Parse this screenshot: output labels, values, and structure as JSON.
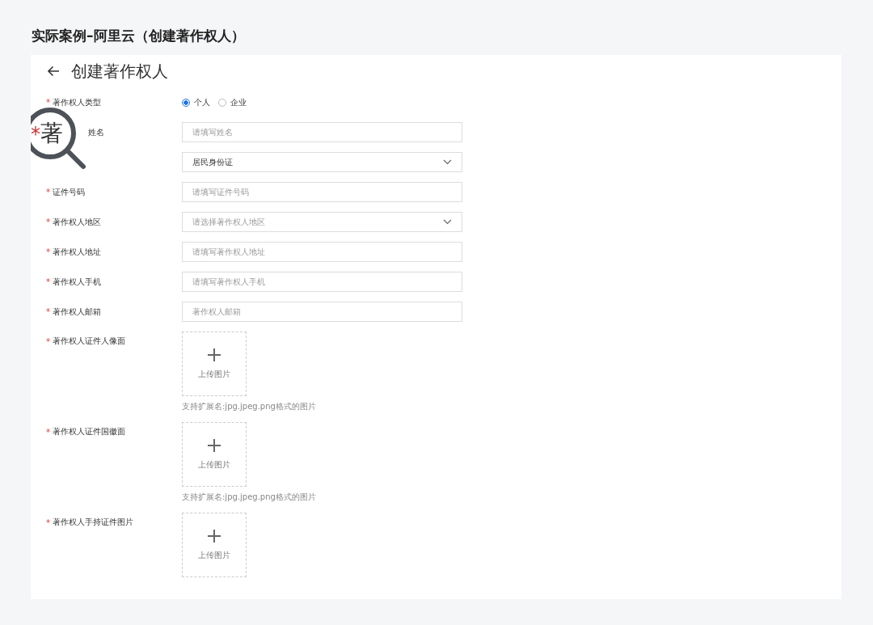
{
  "heading": "实际案例–阿里云（创建著作权人）",
  "page": {
    "title": "创建著作权人"
  },
  "magnifier": {
    "mark": "*",
    "text": "著"
  },
  "fields": [
    {
      "kind": "radio",
      "label": "著作权人类型",
      "required": true,
      "options": [
        {
          "label": "个人",
          "selected": true
        },
        {
          "label": "企业",
          "selected": false
        }
      ]
    },
    {
      "kind": "input",
      "label": "姓名",
      "required": false,
      "covered": true,
      "placeholder": "请填写姓名"
    },
    {
      "kind": "select",
      "required": false,
      "value": "居民身份证"
    },
    {
      "kind": "input",
      "label": "证件号码",
      "required": true,
      "placeholder": "请填写证件号码"
    },
    {
      "kind": "select",
      "label": "著作权人地区",
      "required": true,
      "placeholder": "请选择著作权人地区"
    },
    {
      "kind": "input",
      "label": "著作权人地址",
      "required": true,
      "placeholder": "请填写著作权人地址"
    },
    {
      "kind": "input",
      "label": "著作权人手机",
      "required": true,
      "placeholder": "请填写著作权人手机"
    },
    {
      "kind": "input",
      "label": "著作权人邮箱",
      "required": true,
      "placeholder": "著作权人邮箱"
    },
    {
      "kind": "upload",
      "label": "著作权人证件人像面",
      "required": true,
      "button": "上传图片",
      "hint": "支持扩展名:jpg.jpeg.png格式的图片"
    },
    {
      "kind": "upload",
      "label": "著作权人证件国徽面",
      "required": true,
      "button": "上传图片",
      "hint": "支持扩展名:jpg.jpeg.png格式的图片"
    },
    {
      "kind": "upload",
      "label": "著作权人手持证件图片",
      "required": true,
      "button": "上传图片"
    }
  ]
}
